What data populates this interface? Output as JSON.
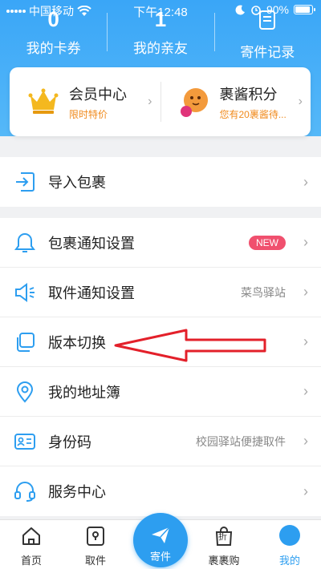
{
  "status_bar": {
    "carrier": "中国移动",
    "time": "下午12:48",
    "battery": "90%",
    "battery_level": 0.9
  },
  "stats": [
    {
      "num": "0",
      "label": "我的卡券"
    },
    {
      "num": "1",
      "label": "我的亲友"
    },
    {
      "num": "",
      "label": "寄件记录"
    }
  ],
  "member": {
    "center_title": "会员中心",
    "center_sub": "限时特价",
    "points_title": "裹酱积分",
    "points_sub": "您有20裹酱待..."
  },
  "import": {
    "label": "导入包裹"
  },
  "menu": [
    {
      "label": "包裹通知设置",
      "badge": "NEW"
    },
    {
      "label": "取件通知设置",
      "value": "菜鸟驿站"
    },
    {
      "label": "版本切换"
    },
    {
      "label": "我的地址簿"
    },
    {
      "label": "身份码",
      "value": "校园驿站便捷取件"
    },
    {
      "label": "服务中心"
    }
  ],
  "tabs": {
    "home": "首页",
    "pickup": "取件",
    "send": "寄件",
    "shop": "裹裹购",
    "shop_badge": "折",
    "me": "我的"
  },
  "colors": {
    "primary": "#2d9ef0",
    "header": "#3aa6f7",
    "accent_orange": "#f08a1c",
    "badge_red": "#f0506e",
    "arrow_red": "#e3202a"
  }
}
